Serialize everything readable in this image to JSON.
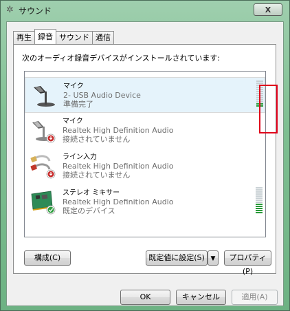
{
  "window": {
    "title": "サウンド",
    "close_label": "X"
  },
  "tabs": [
    {
      "label": "再生"
    },
    {
      "label": "録音"
    },
    {
      "label": "サウンド"
    },
    {
      "label": "通信"
    }
  ],
  "prompt": "次のオーディオ録音デバイスがインストールされています:",
  "devices": [
    {
      "name": "マイク",
      "driver": "2- USB Audio Device",
      "status": "準備完了",
      "icon": "microphone-icon",
      "selected": true,
      "level": 0.15
    },
    {
      "name": "マイク",
      "driver": "Realtek High Definition Audio",
      "status": "接続されていません",
      "icon": "microphone-icon",
      "badge": "disconnected-badge-icon"
    },
    {
      "name": "ライン入力",
      "driver": "Realtek High Definition Audio",
      "status": "接続されていません",
      "icon": "line-in-cable-icon",
      "badge": "disconnected-badge-icon"
    },
    {
      "name": "ステレオ ミキサー",
      "driver": "Realtek High Definition Audio",
      "status": "既定のデバイス",
      "icon": "sound-card-icon",
      "badge": "default-check-icon",
      "level": 0.4
    }
  ],
  "buttons": {
    "configure": "構成(C)",
    "set_default": "既定値に設定(S)",
    "properties": "プロパティ(P)",
    "ok": "OK",
    "cancel": "キャンセル",
    "apply": "適用(A)"
  },
  "colors": {
    "highlight": "#e0001a",
    "meter_on": "#2a9a3a",
    "meter_off": "#c8d0d4",
    "selected_row": "#e5f3fb"
  }
}
